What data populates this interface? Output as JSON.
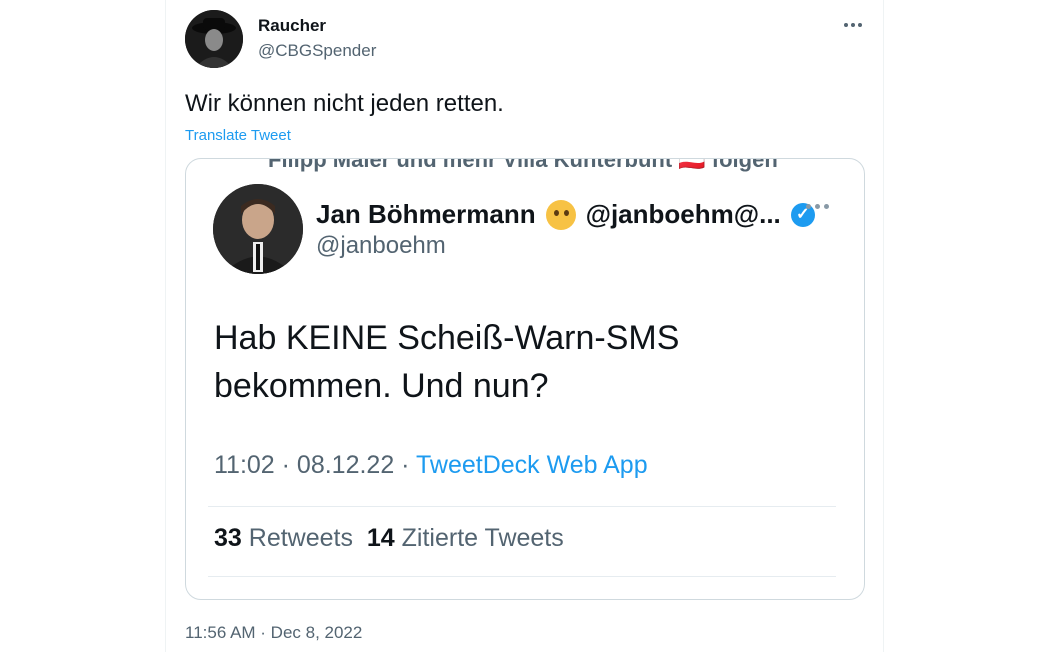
{
  "tweet": {
    "author_name": "Raucher",
    "author_handle": "@CBGSpender",
    "text": "Wir können nicht jeden retten.",
    "translate_label": "Translate Tweet",
    "timestamp": "11:56 AM · Dec 8, 2022"
  },
  "embedded_screenshot": {
    "cut_off_line": "Filipp Maier und mehr Villa Kunterbunt 🇦🇹 folgen",
    "author_name": "Jan Böhmermann",
    "author_name_suffix": "@janboehm@...",
    "author_handle": "@janboehm",
    "text": "Hab KEINE Scheiß-Warn-SMS bekommen. Und nun?",
    "time": "11:02 · 08.12.22 · ",
    "app": "TweetDeck Web App",
    "retweets_count": "33",
    "retweets_label": "Retweets",
    "quotes_count": "14",
    "quotes_label": "Zitierte Tweets"
  }
}
